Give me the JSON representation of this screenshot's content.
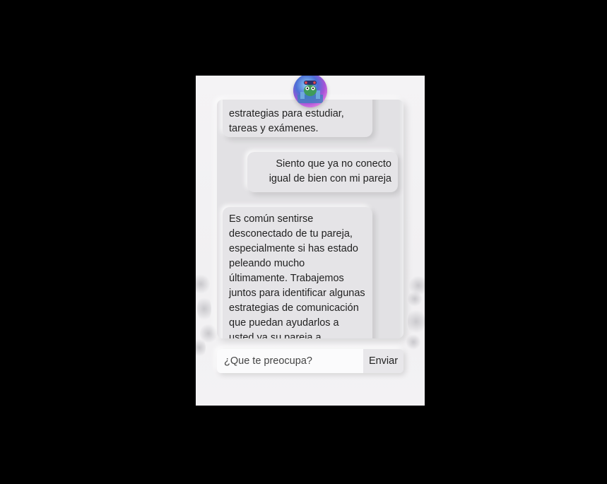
{
  "chat": {
    "messages": [
      {
        "role": "bot",
        "text": "estrategias para estudiar, tareas y exámenes."
      },
      {
        "role": "user",
        "text": "Siento que ya no conecto igual de bien con mi pareja"
      },
      {
        "role": "bot",
        "text": "Es común sentirse desconectado de tu pareja, especialmente si has estado peleando mucho últimamente. Trabajemos juntos para identificar algunas estrategias de comunicación que puedan ayudarlos a usted ya su pareja a comprender mejor las"
      }
    ]
  },
  "composer": {
    "placeholder": "¿Que te preocupa?",
    "send_label": "Enviar"
  },
  "avatar": {
    "icon": "robot-avatar-icon"
  },
  "colors": {
    "page_background": "#000000",
    "app_background": "#f2f1f3",
    "bubble": "#e5e4e7",
    "input": "#fbfbfc"
  }
}
